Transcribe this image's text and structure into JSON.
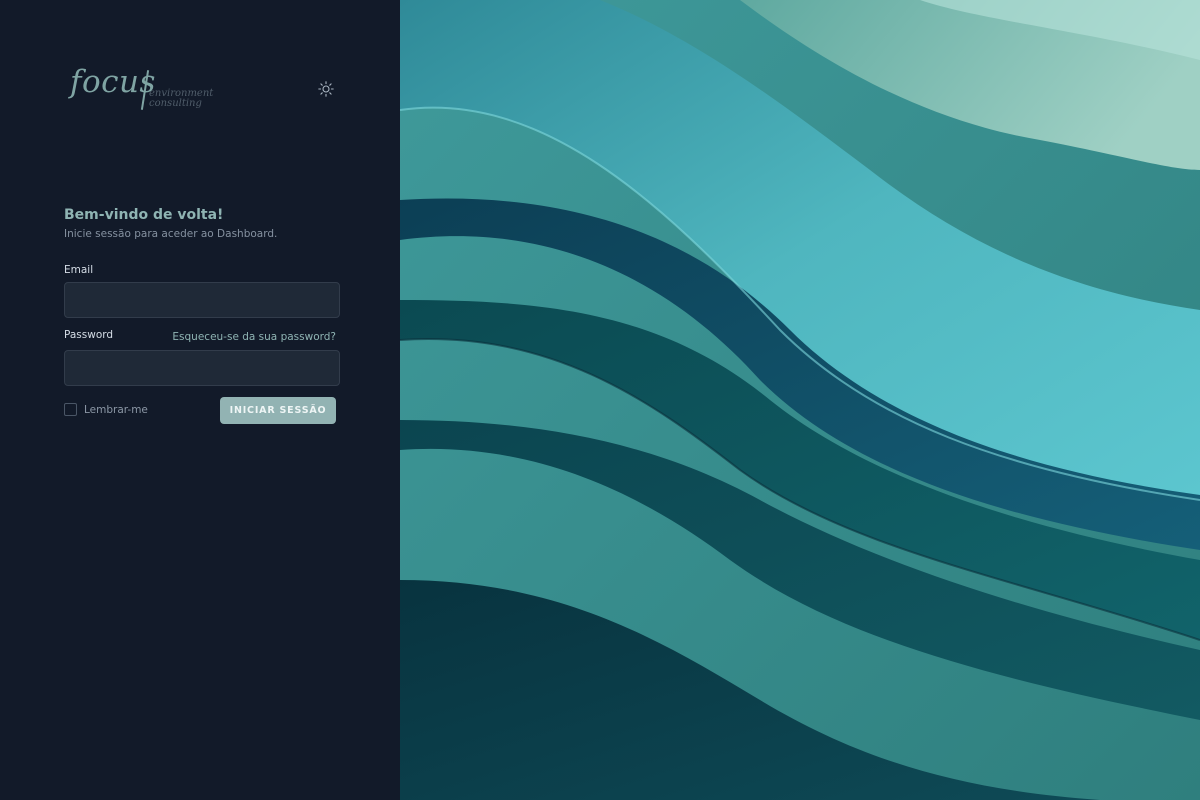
{
  "logo": {
    "brand": "focus",
    "line1": "environment",
    "line2": "consulting"
  },
  "theme_toggle": {
    "icon": "sun-icon"
  },
  "login": {
    "welcome": "Bem-vindo de volta!",
    "subtitle": "Inicie sessão para aceder ao Dashboard.",
    "email_label": "Email",
    "email_value": "",
    "password_label": "Password",
    "password_value": "",
    "forgot_password": "Esqueceu-se da sua password?",
    "remember_me": "Lembrar-me",
    "remember_checked": false,
    "submit": "INICIAR SESSÃO"
  },
  "colors": {
    "panel_bg": "#121a29",
    "accent": "#8fb4b3",
    "button_bg": "#92b3b3",
    "input_bg": "#1f2937"
  }
}
